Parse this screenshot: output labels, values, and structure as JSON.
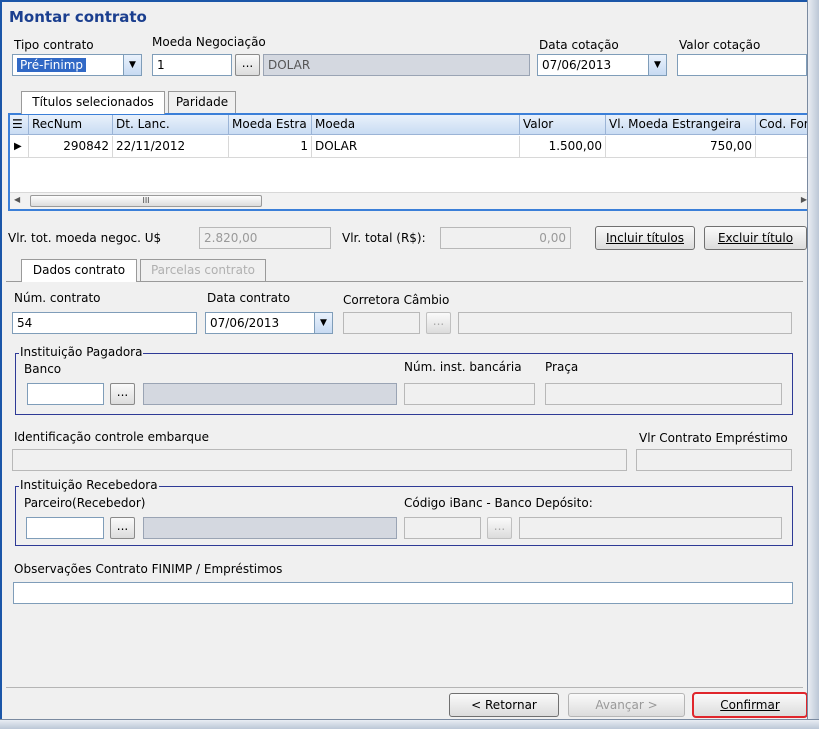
{
  "window": {
    "title": "Montar contrato"
  },
  "header": {
    "tipo_contrato_label": "Tipo contrato",
    "tipo_contrato_value": "Pré-Finimp",
    "moeda_label": "Moeda Negociação",
    "moeda_code": "1",
    "moeda_name": "DOLAR",
    "lookup_label": "...",
    "data_cotacao_label": "Data cotação",
    "data_cotacao_value": "07/06/2013",
    "valor_cotacao_label": "Valor cotação",
    "valor_cotacao_value": ""
  },
  "top_tabs": [
    {
      "label": "Títulos selecionados",
      "active": true
    },
    {
      "label": "Paridade",
      "active": false
    }
  ],
  "grid": {
    "columns": [
      "RecNum",
      "Dt. Lanc.",
      "Moeda Estra",
      "Moeda",
      "Valor",
      "Vl. Moeda Estrangeira",
      "Cod. For"
    ],
    "rows": [
      {
        "recnum": "290842",
        "dt_lanc": "22/11/2012",
        "moeda_estra": "1",
        "moeda": "DOLAR",
        "valor": "1.500,00",
        "vl_moeda_estrangeira": "750,00",
        "cod_for": ""
      }
    ],
    "scroll_thumb_label": "III"
  },
  "totals": {
    "vlr_tot_label": "Vlr. tot. moeda negoc. U$",
    "vlr_tot_value": "2.820,00",
    "vlr_total_label": "Vlr. total (R$):",
    "vlr_total_value": "0,00",
    "incluir_label": "Incluir títulos",
    "excluir_label": "Excluir título"
  },
  "bottom_tabs": [
    {
      "label": "Dados contrato",
      "active": true
    },
    {
      "label": "Parcelas contrato",
      "active": false
    }
  ],
  "dados": {
    "num_contrato_label": "Núm. contrato",
    "num_contrato_value": "54",
    "data_contrato_label": "Data contrato",
    "data_contrato_value": "07/06/2013",
    "corretora_label": "Corretora Câmbio",
    "inst_pagadora_title": "Instituição Pagadora",
    "banco_label": "Banco",
    "num_inst_label": "Núm. inst. bancária",
    "praca_label": "Praça",
    "ident_label": "Identificação controle embarque",
    "vlr_emprestimo_label": "Vlr Contrato Empréstimo",
    "inst_recebedora_title": "Instituição Recebedora",
    "parceiro_label": "Parceiro(Recebedor)",
    "codigo_ibanc_label": "Código iBanc - Banco Depósito:",
    "obs_label": "Observações Contrato FINIMP / Empréstimos"
  },
  "footer": {
    "retornar_label": "< Retornar",
    "avancar_label": "Avançar >",
    "confirmar_label": "Confirmar"
  },
  "colors": {
    "title_blue": "#1b3f8f",
    "selected_combo": "#3169c6",
    "group_border": "#2e3a96",
    "highlight_red": "#e0262c"
  }
}
